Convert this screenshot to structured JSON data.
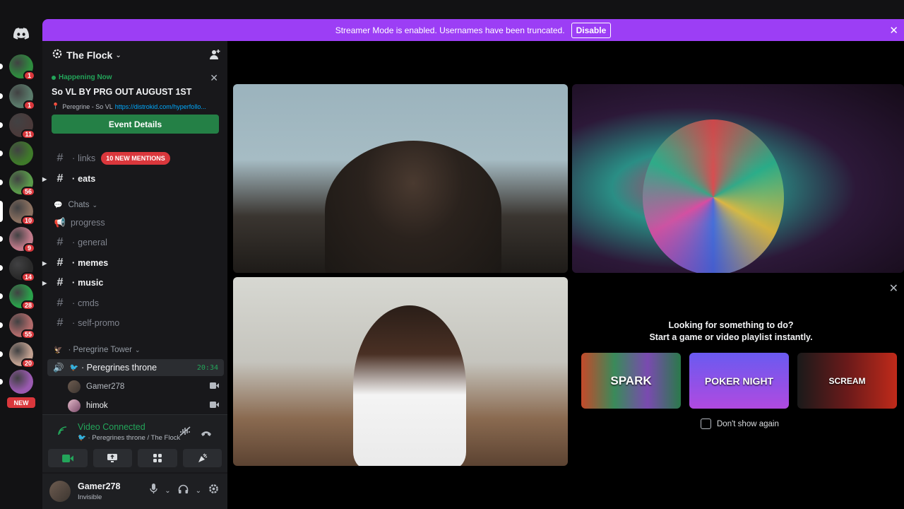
{
  "banner": {
    "text": "Streamer Mode is enabled. Usernames have been truncated.",
    "button": "Disable"
  },
  "rail": {
    "servers": [
      {
        "badge": "1",
        "color": "#2e8b3e"
      },
      {
        "badge": "1",
        "color": "#5a7a6a"
      },
      {
        "badge": "11",
        "color": "#4a3a3a"
      },
      {
        "badge": "",
        "color": "#3f7a2a"
      },
      {
        "badge": "56",
        "color": "#5a9a4a"
      },
      {
        "badge": "10",
        "color": "#8a7060"
      },
      {
        "badge": "9",
        "color": "#c07a8a"
      },
      {
        "badge": "14",
        "color": "#2a2a2a"
      },
      {
        "badge": "28",
        "color": "#2aa04a"
      },
      {
        "badge": "55",
        "color": "#b06a6a"
      },
      {
        "badge": "20",
        "color": "#c0a090"
      },
      {
        "badge": "",
        "color": "#9a5ab0"
      }
    ],
    "new_label": "NEW"
  },
  "guild": {
    "name": "The Flock"
  },
  "event": {
    "status": "Happening Now",
    "title": "So VL BY PRG OUT AUGUST 1ST",
    "location": "Peregrine - So VL",
    "link": "https://distrokid.com/hyperfollo...",
    "button": "Event Details"
  },
  "channels": {
    "links": "links",
    "mentions": "10 NEW MENTIONS",
    "eats": "eats",
    "cat_chats": "Chats",
    "progress": "progress",
    "general": "general",
    "memes": "memes",
    "music": "music",
    "cmds": "cmds",
    "self_promo": "self-promo",
    "cat_tower": "Peregrine Tower",
    "voice_channel": "Peregrines throne",
    "voice_time": "20:34",
    "voice_users": [
      "Gamer278",
      "himok"
    ]
  },
  "voice_panel": {
    "status": "Video Connected",
    "sub": "Peregrines throne / The Flock"
  },
  "user": {
    "name": "Gamer278",
    "status": "Invisible"
  },
  "activity": {
    "line1": "Looking for something to do?",
    "line2": "Start a game or video playlist instantly.",
    "games": [
      "SPARK",
      "POKER NIGHT",
      "SCREAM"
    ],
    "dont_show": "Don't show again"
  },
  "colors": {
    "brand": "#9c3ef5",
    "green": "#23a55a",
    "red": "#da373c"
  }
}
